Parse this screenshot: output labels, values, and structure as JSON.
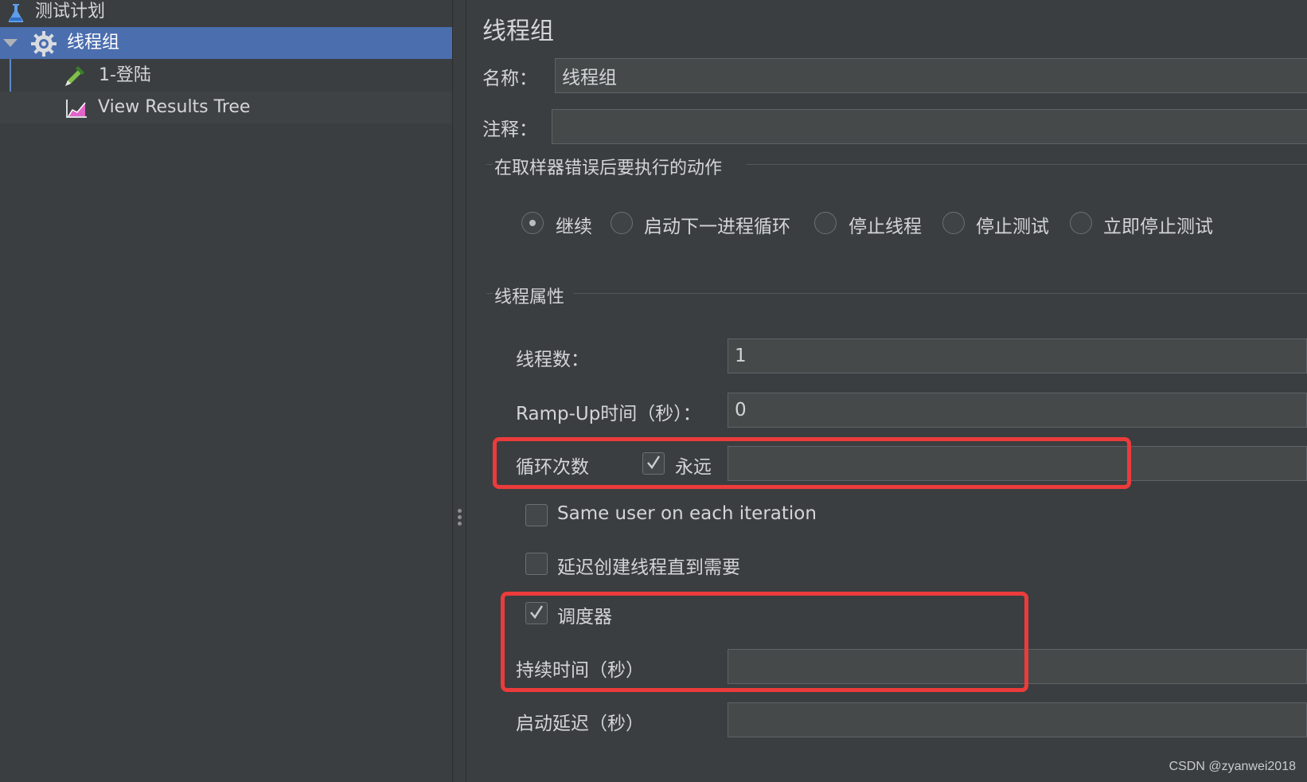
{
  "tree": {
    "items": [
      {
        "label": "测试计划",
        "icon": "flask-icon"
      },
      {
        "label": "线程组",
        "icon": "gear-icon",
        "selected": true,
        "expanded": true
      },
      {
        "label": "1-登陆",
        "icon": "pipette-icon"
      },
      {
        "label": "View Results Tree",
        "icon": "chart-icon"
      }
    ]
  },
  "panel": {
    "title": "线程组",
    "name_label": "名称：",
    "name_value": "线程组",
    "comment_label": "注释：",
    "comment_value": "",
    "on_error": {
      "legend": "在取样器错误后要执行的动作",
      "options": [
        "继续",
        "启动下一进程循环",
        "停止线程",
        "停止测试",
        "立即停止测试"
      ],
      "selected": "继续"
    },
    "thread_props": {
      "legend": "线程属性",
      "threads_label": "线程数：",
      "threads_value": "1",
      "rampup_label": "Ramp-Up时间（秒）：",
      "rampup_value": "0",
      "loop_label": "循环次数",
      "forever_label": "永远",
      "forever_checked": true,
      "loop_value": "",
      "same_user_label": "Same user on each iteration",
      "same_user_checked": false,
      "delay_create_label": "延迟创建线程直到需要",
      "delay_create_checked": false,
      "scheduler_label": "调度器",
      "scheduler_checked": true,
      "duration_label": "持续时间（秒）",
      "duration_value": "",
      "startup_delay_label": "启动延迟（秒）",
      "startup_delay_value": ""
    }
  },
  "highlight_color": "#ec3b3b",
  "selection_color": "#4b6eaf",
  "watermark": "CSDN @zyanwei2018"
}
